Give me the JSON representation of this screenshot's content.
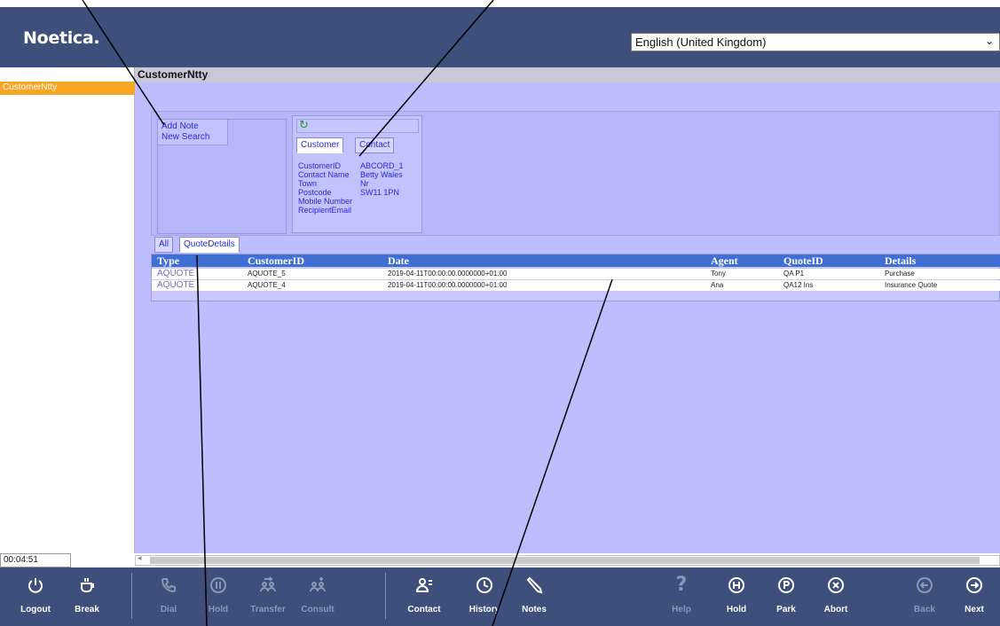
{
  "app": {
    "logo": "Noetica."
  },
  "language": {
    "selected": "English (United Kingdom)"
  },
  "left_panel": {
    "items": [
      {
        "label": "CustomerNtty"
      }
    ]
  },
  "main": {
    "title": "CustomerNtty"
  },
  "actions": {
    "links": [
      {
        "label": "Add Note"
      },
      {
        "label": "New Search"
      }
    ]
  },
  "detail": {
    "tabs": [
      {
        "label": "Customer",
        "active": true
      },
      {
        "label": "Contact",
        "active": false
      }
    ],
    "fields": [
      {
        "label": "CustomerID",
        "value": "ABCORD_1"
      },
      {
        "label": "Contact Name",
        "value": "Betty Wales"
      },
      {
        "label": "Town",
        "value": "Nr"
      },
      {
        "label": "Postcode",
        "value": "SW11 1PN"
      },
      {
        "label": "Mobile Number",
        "value": ""
      },
      {
        "label": "RecipientEmail",
        "value": ""
      }
    ]
  },
  "grid": {
    "tabs": [
      {
        "label": "All",
        "active": false
      },
      {
        "label": "QuoteDetails",
        "active": true
      }
    ],
    "columns": [
      "Type",
      "CustomerID",
      "Date",
      "Agent",
      "QuoteID",
      "Details"
    ],
    "rows": [
      {
        "type": "AQUOTE",
        "customer_id": "AQUOTE_5",
        "date": "2019-04-11T00:00:00.0000000+01:00",
        "agent": "Tony",
        "quote_id": "QA P1",
        "details": "Purchase"
      },
      {
        "type": "AQUOTE",
        "customer_id": "AQUOTE_4",
        "date": "2019-04-11T00:00:00.0000000+01:00",
        "agent": "Ana",
        "quote_id": "QA12 Ins",
        "details": "Insurance Quote"
      }
    ]
  },
  "status": {
    "timer": "00:04:51"
  },
  "toolbar": {
    "buttons": [
      {
        "label": "Logout",
        "icon": "power-icon",
        "enabled": true
      },
      {
        "label": "Break",
        "icon": "coffee-cup-icon",
        "enabled": true
      },
      {
        "label": "Dial",
        "icon": "phone-icon",
        "enabled": false
      },
      {
        "label": "Hold",
        "icon": "pause-icon",
        "enabled": false
      },
      {
        "label": "Transfer",
        "icon": "transfer-icon",
        "enabled": false
      },
      {
        "label": "Consult",
        "icon": "consult-icon",
        "enabled": false
      },
      {
        "label": "Contact",
        "icon": "contact-icon",
        "enabled": true
      },
      {
        "label": "History",
        "icon": "clock-icon",
        "enabled": true
      },
      {
        "label": "Notes",
        "icon": "pencil-icon",
        "enabled": true
      },
      {
        "label": "Help",
        "icon": "question-icon",
        "enabled": false
      },
      {
        "label": "Hold",
        "icon": "hold-h-icon",
        "enabled": true
      },
      {
        "label": "Park",
        "icon": "park-p-icon",
        "enabled": true
      },
      {
        "label": "Abort",
        "icon": "abort-x-icon",
        "enabled": true
      },
      {
        "label": "Back",
        "icon": "back-arrow-icon",
        "enabled": false
      },
      {
        "label": "Next",
        "icon": "next-arrow-icon",
        "enabled": true
      }
    ]
  },
  "colors": {
    "header": "#3d4f7a",
    "accent": "#f6a623",
    "panel": "#bebeff",
    "grid_header": "#3f6fd5"
  }
}
